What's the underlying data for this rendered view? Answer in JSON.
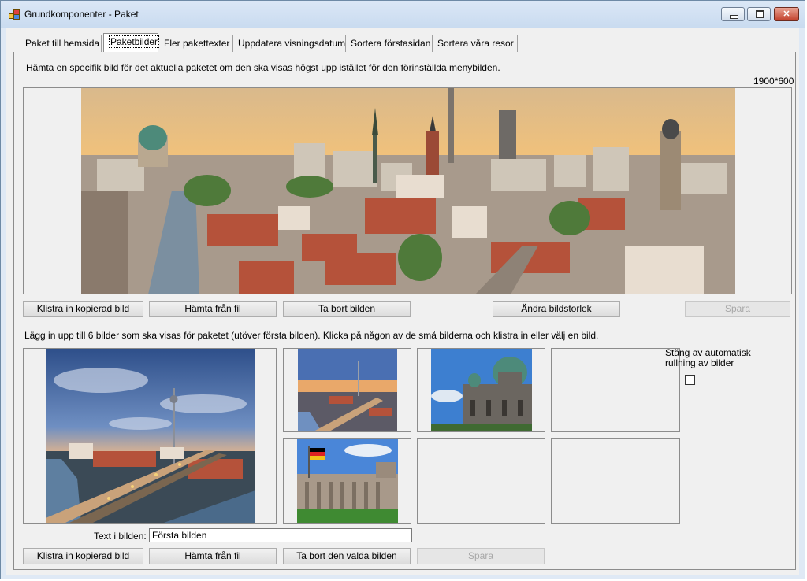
{
  "window": {
    "title": "Grundkomponenter - Paket",
    "minimize_glyph": "",
    "close_glyph": "✕"
  },
  "tabs": [
    {
      "label": "Paket till hemsida"
    },
    {
      "label": "Paketbilder",
      "selected": true
    },
    {
      "label": "Fler pakettexter"
    },
    {
      "label": "Uppdatera visningsdatum"
    },
    {
      "label": "Sortera förstasidan"
    },
    {
      "label": "Sortera våra resor"
    }
  ],
  "top_section": {
    "description": "Hämta en specifik bild för det aktuella paketet om den ska visas högst upp istället för den förinställda menybilden.",
    "size_label": "1900*600",
    "image_subject": "berlin-city-panorama",
    "buttons": {
      "paste": "Klistra in kopierad bild",
      "from_file": "Hämta från fil",
      "remove": "Ta bort bilden",
      "resize": "Ändra bildstorlek",
      "save": "Spara"
    }
  },
  "gallery_section": {
    "description": "Lägg in upp till 6 bilder som ska visas för paketet (utöver första bilden). Klicka på någon av de små bilderna och klistra in eller välj en bild.",
    "large_image_subject": "berlin-tv-tower-river-dusk",
    "thumbnails": [
      {
        "subject": "berlin-city-skyline-dusk"
      },
      {
        "subject": "berlin-cathedral"
      },
      {
        "subject": ""
      },
      {
        "subject": "reichstag-building"
      },
      {
        "subject": ""
      },
      {
        "subject": ""
      }
    ],
    "autoscroll_label": "Stäng av automatisk rullning av bilder",
    "autoscroll_checked": false,
    "text_label": "Text i bilden:",
    "text_value": "Första bilden",
    "buttons": {
      "paste": "Klistra in kopierad bild",
      "from_file": "Hämta från fil",
      "remove": "Ta bort den valda bilden",
      "save": "Spara"
    }
  },
  "colors": {
    "sky_warm": "#f2c27a",
    "sky_dusk": "#3a5a9a",
    "roof_red": "#b5523a",
    "dome_green": "#4d8a7a"
  }
}
